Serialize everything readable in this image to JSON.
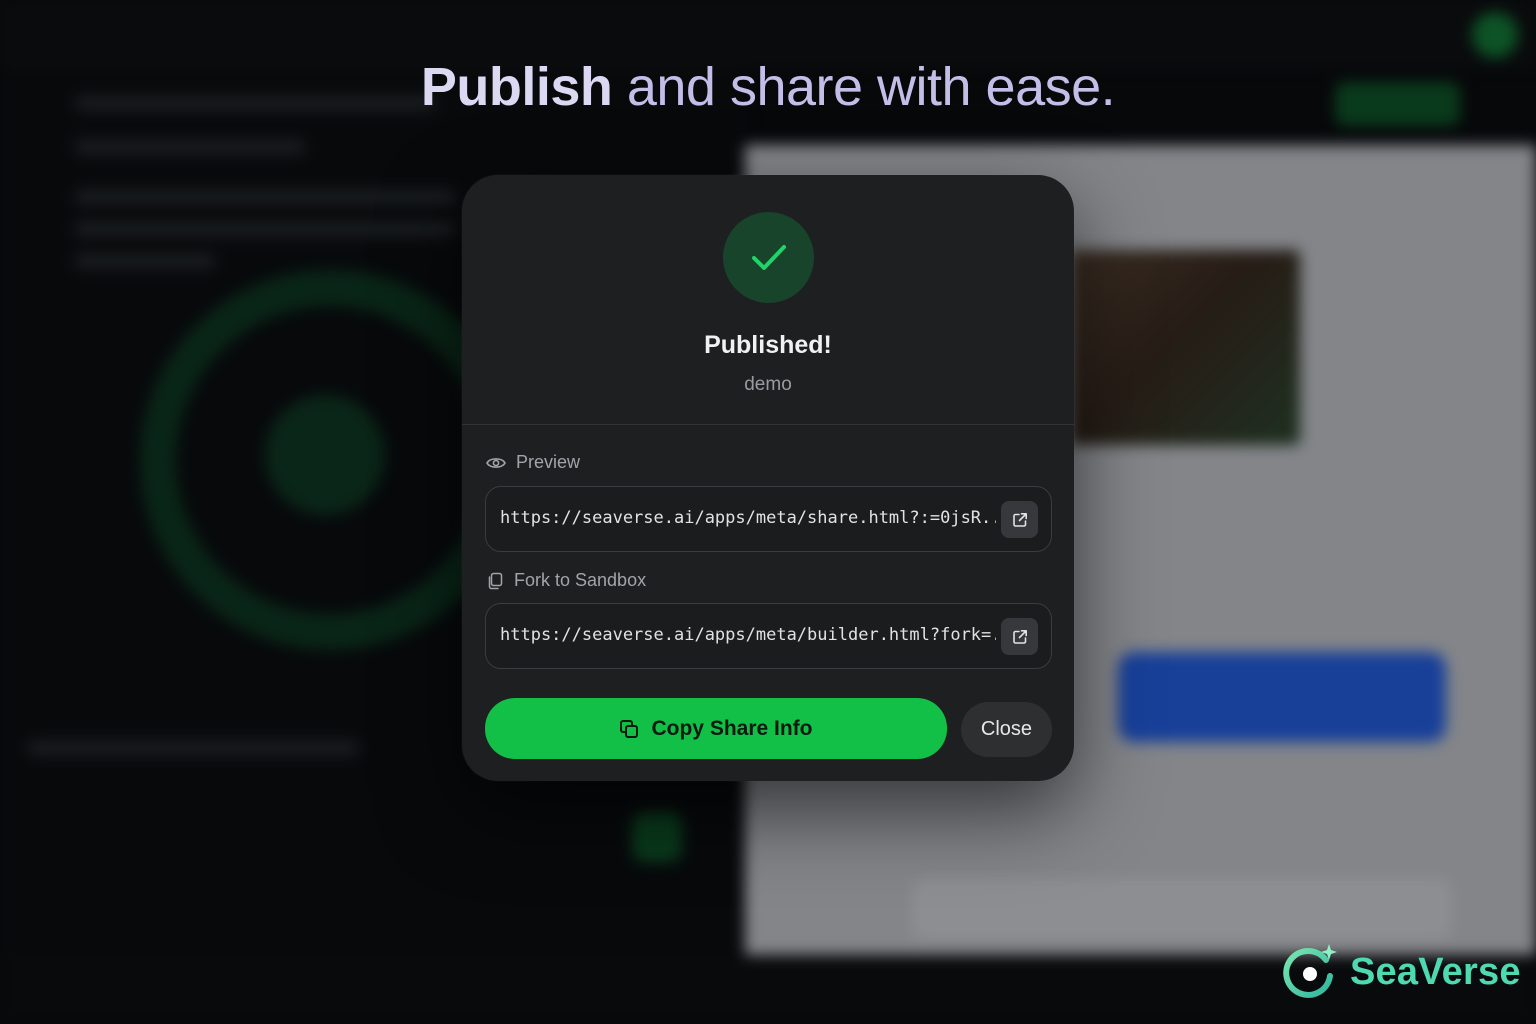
{
  "headline": {
    "strong": "Publish",
    "rest": " and share with ease."
  },
  "dialog": {
    "title": "Published!",
    "subtitle": "demo",
    "preview": {
      "label": "Preview",
      "url": "https://seaverse.ai/apps/meta/share.html?:=0jsR..."
    },
    "fork": {
      "label": "Fork to Sandbox",
      "url": "https://seaverse.ai/apps/meta/builder.html?fork=..."
    },
    "copy_button": "Copy Share Info",
    "close_button": "Close"
  },
  "brand": {
    "name": "SeaVerse"
  },
  "colors": {
    "accent_green": "#12c048",
    "check_green": "#22d36a",
    "brand_teal": "#4fd9b0"
  }
}
